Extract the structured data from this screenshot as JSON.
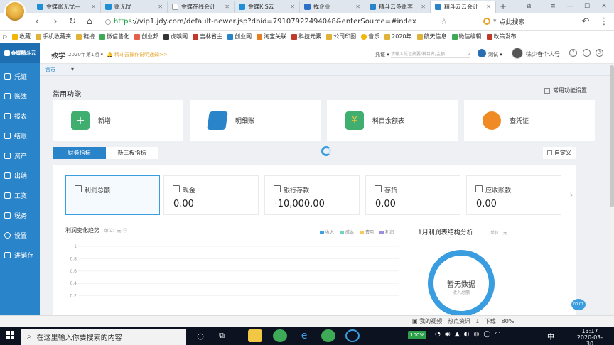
{
  "browser": {
    "tabs": [
      {
        "label": "金蝶账无忧—",
        "active": false
      },
      {
        "label": "账无忧",
        "active": false
      },
      {
        "label": "金蝶在线会计",
        "active": false
      },
      {
        "label": "金蝶KIS云",
        "active": false
      },
      {
        "label": "找企业",
        "active": false
      },
      {
        "label": "精斗云多账套",
        "active": false
      },
      {
        "label": "精斗云云会计",
        "active": true
      }
    ],
    "new_tab": "+",
    "url_https": "https",
    "url_rest": "://vip1.jdy.com/default-newer.jsp?dbid=79107922494048&enterSource=#index",
    "search_placeholder": "点此搜索",
    "bookmarks": [
      "收藏",
      "手机收藏夹",
      "链接",
      "微信售化",
      "创业邦",
      "虎嗅网",
      "吉林省主",
      "创业网",
      "淘宝关联",
      "科技元素",
      "公司印图",
      "音乐",
      "2020年",
      "航天信息",
      "微信编辑",
      "政策发布"
    ]
  },
  "app": {
    "logo": "金蝶精斗云",
    "nav": [
      "凭证",
      "账簿",
      "报表",
      "结账",
      "资产",
      "出纳",
      "工资",
      "税务",
      "设置",
      "进销存"
    ],
    "account_name": "教学",
    "period": "2020年第1期",
    "notice": "精斗云操作说明通知>>",
    "voucher_dropdown": "凭证",
    "search_placeholder": "请输入凭证摘要/科目名/金额",
    "user_role": "测试",
    "user_name": "徐少春个人号",
    "breadcrumb_tab": "首页",
    "common_functions_title": "常用功能",
    "common_settings": "常用功能设置",
    "quick_actions": [
      "新增",
      "明细账",
      "科目余额表",
      "查凭证"
    ],
    "tabs": [
      "财务指标",
      "新三板指标"
    ],
    "customize": "自定义",
    "metrics": [
      {
        "label": "利润总额",
        "value": ""
      },
      {
        "label": "现金",
        "value": "0.00"
      },
      {
        "label": "银行存款",
        "value": "-10,000.00"
      },
      {
        "label": "存货",
        "value": "0.00"
      },
      {
        "label": "应收账款",
        "value": "0.00"
      }
    ],
    "chart_title": "利润变化趋势",
    "chart_unit": "单位：元",
    "legend": [
      "收入",
      "成本",
      "费用",
      "利润"
    ],
    "pie_title": "1月利润表结构分析",
    "pie_unit": "单位：元",
    "no_data": "暂无数据",
    "no_data_sub": "收入总额",
    "help_bubble": "00:01",
    "colors": {
      "accent": "#2a84c9",
      "legend": [
        "#3ea0e8",
        "#6fd6c4",
        "#f8c95a",
        "#9b8fe0"
      ],
      "ring": "#3a9de0"
    }
  },
  "chart_data": {
    "type": "line",
    "title": "利润变化趋势",
    "ylabel": "",
    "ylim": [
      0,
      1
    ],
    "y_ticks": [
      "1",
      "0.8",
      "0.6",
      "0.4",
      "0.2"
    ],
    "series": []
  },
  "statusbar": {
    "items": [
      "我的视频",
      "热点资讯",
      "下载",
      "80%"
    ]
  },
  "taskbar": {
    "search_placeholder": "在这里输入你要搜索的内容",
    "battery": "100%",
    "lang": "中",
    "time": "13:17",
    "date": "2020-03-30"
  }
}
